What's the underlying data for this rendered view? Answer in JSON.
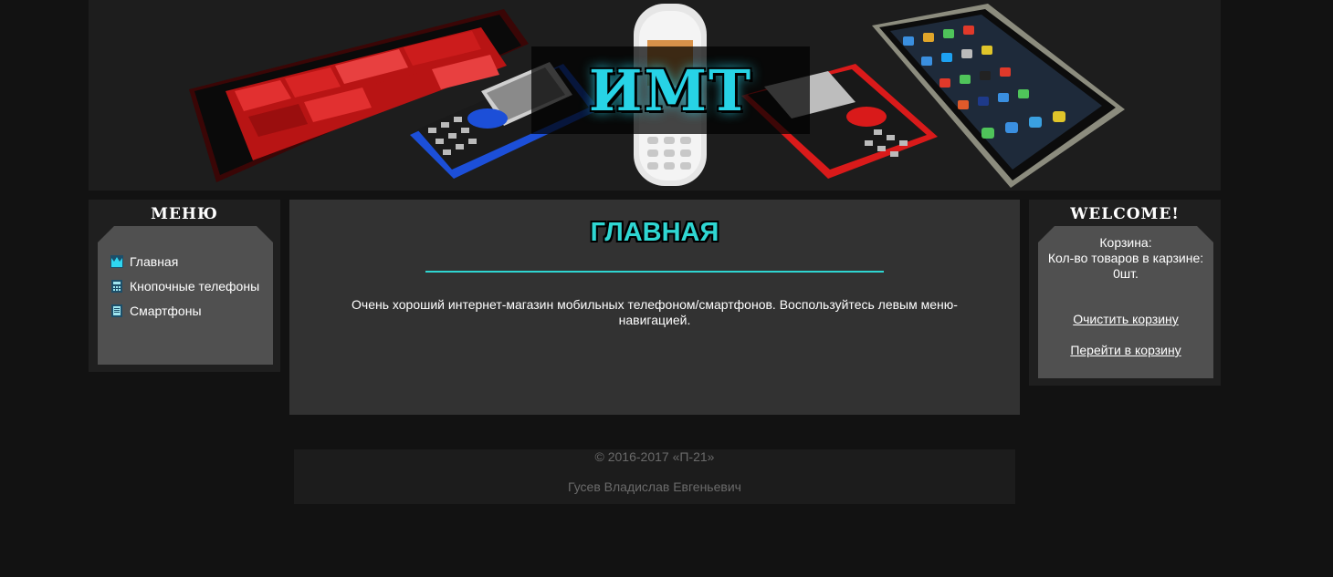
{
  "header": {
    "logo": "ИМТ"
  },
  "menu": {
    "title": "МЕНЮ",
    "items": [
      {
        "label": "Главная",
        "icon": "crown-icon"
      },
      {
        "label": "Кнопочные телефоны",
        "icon": "calculator-icon"
      },
      {
        "label": "Смартфоны",
        "icon": "document-icon"
      }
    ]
  },
  "main": {
    "title": "ГЛАВНАЯ",
    "text": "Очень хороший интернет-магазин мобильных телефоном/смартфонов. Воспользуйтесь левым меню-навигацией."
  },
  "sidebar_right": {
    "title": "WELCOME!",
    "cart_label": "Корзина:",
    "cart_count_label": "Кол-во товаров в карзине:",
    "cart_count": "0шт.",
    "clear_cart": "Очистить корзину",
    "go_to_cart": "Перейти в корзину"
  },
  "footer": {
    "copyright": "© 2016-2017 «П-21»",
    "author": "Гусев Владислав Евгеньевич"
  },
  "colors": {
    "accent": "#2fd6d2",
    "background": "#121212",
    "panel": "#1f1f1f",
    "panel_inner": "#505050",
    "main": "#323232"
  }
}
